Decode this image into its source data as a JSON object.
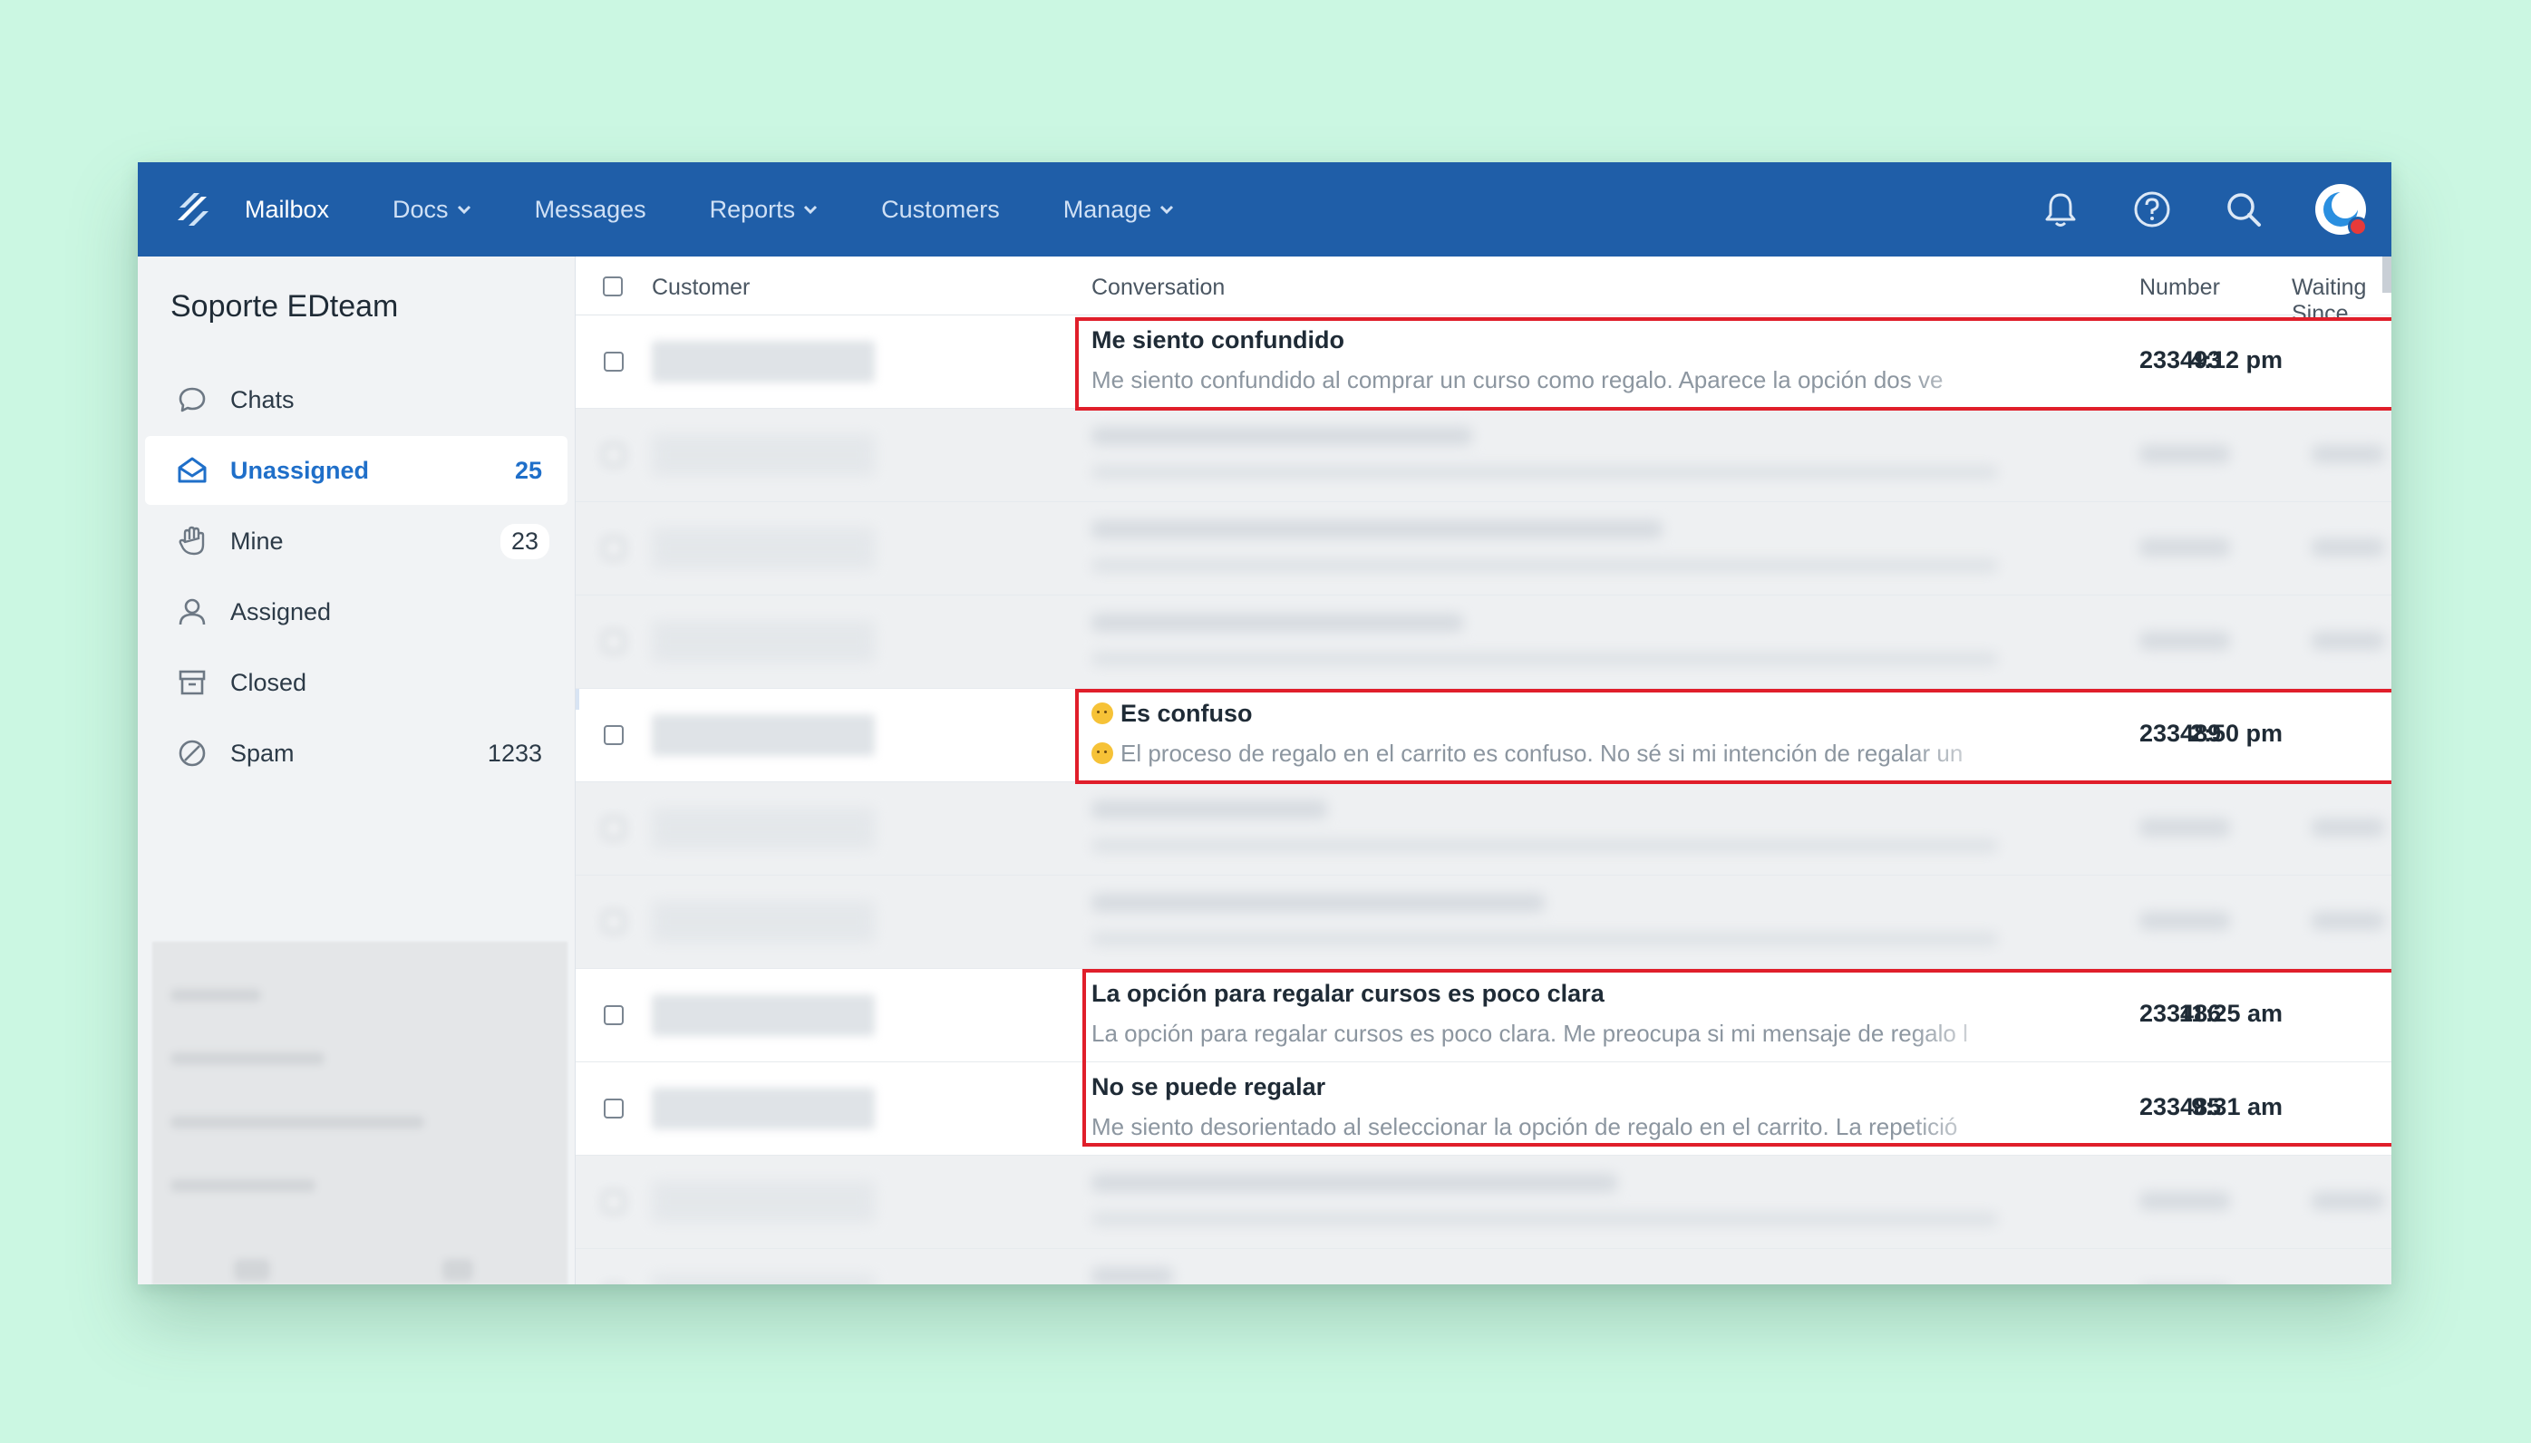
{
  "nav": {
    "items": [
      {
        "label": "Mailbox",
        "active": true,
        "dropdown": false
      },
      {
        "label": "Docs",
        "active": false,
        "dropdown": true
      },
      {
        "label": "Messages",
        "active": false,
        "dropdown": false
      },
      {
        "label": "Reports",
        "active": false,
        "dropdown": true
      },
      {
        "label": "Customers",
        "active": false,
        "dropdown": false
      },
      {
        "label": "Manage",
        "active": false,
        "dropdown": true
      }
    ],
    "icons": [
      "bell-icon",
      "help-icon",
      "search-icon",
      "avatar"
    ]
  },
  "sidebar": {
    "title": "Soporte EDteam",
    "items": [
      {
        "label": "Chats",
        "count": "",
        "icon": "chat-icon"
      },
      {
        "label": "Unassigned",
        "count": "25",
        "icon": "inbox-icon",
        "active": true
      },
      {
        "label": "Mine",
        "count": "23",
        "icon": "hand-icon"
      },
      {
        "label": "Assigned",
        "count": "",
        "icon": "user-icon"
      },
      {
        "label": "Closed",
        "count": "",
        "icon": "archive-icon"
      },
      {
        "label": "Spam",
        "count": "1233",
        "icon": "spam-icon"
      }
    ]
  },
  "table": {
    "headers": {
      "customer": "Customer",
      "conversation": "Conversation",
      "number": "Number",
      "waiting": "Waiting Since"
    },
    "rows": [
      {
        "subject": "Me siento confundido",
        "preview": "Me siento confundido al comprar un curso como regalo. Aparece la opción dos ve",
        "number": "233493",
        "time": "4:12 pm",
        "emoji": false,
        "visible": true
      },
      {
        "subject": "",
        "preview": "",
        "number": "",
        "time": "",
        "emoji": false,
        "visible": false
      },
      {
        "subject": "",
        "preview": "",
        "number": "",
        "time": "",
        "emoji": false,
        "visible": false
      },
      {
        "subject": "",
        "preview": "",
        "number": "",
        "time": "",
        "emoji": false,
        "visible": false
      },
      {
        "subject": "Es confuso",
        "preview": "El proceso de regalo en el carrito es confuso. No sé si mi intención de regalar un",
        "number": "233489",
        "time": "2:50 pm",
        "emoji": true,
        "visible": true
      },
      {
        "subject": "",
        "preview": "",
        "number": "",
        "time": "",
        "emoji": false,
        "visible": false
      },
      {
        "subject": "",
        "preview": "",
        "number": "",
        "time": "",
        "emoji": false,
        "visible": false
      },
      {
        "subject": "La opción para regalar cursos es poco clara",
        "preview": "La opción para regalar cursos es poco clara. Me preocupa si mi mensaje de regalo l",
        "number": "233486",
        "time": "11:25 am",
        "emoji": false,
        "visible": true
      },
      {
        "subject": "No se puede regalar",
        "preview": "Me siento desorientado al seleccionar la opción de regalo en el carrito. La repetició",
        "number": "233485",
        "time": "9:31 am",
        "emoji": false,
        "visible": true
      },
      {
        "subject": "",
        "preview": "",
        "number": "",
        "time": "",
        "emoji": false,
        "visible": false
      },
      {
        "subject": "",
        "preview": "",
        "number": "",
        "time": "",
        "emoji": false,
        "visible": false
      }
    ]
  },
  "colors": {
    "nav": "#1f5ea8",
    "accent": "#1f6fc9",
    "highlight": "#e01e2a",
    "background": "#cbf7e2"
  }
}
